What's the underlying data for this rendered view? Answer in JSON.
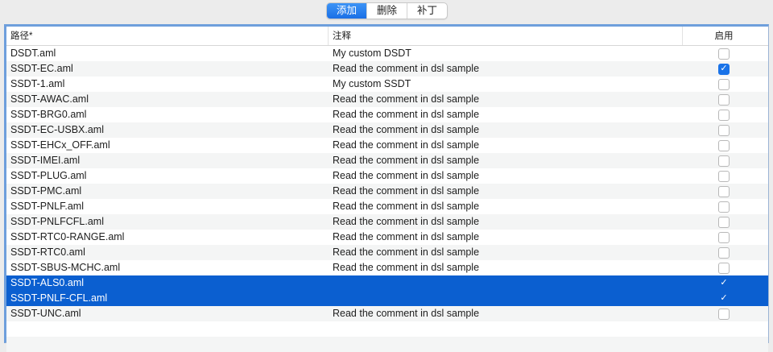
{
  "tabs": [
    {
      "label": "添加",
      "active": true
    },
    {
      "label": "删除",
      "active": false
    },
    {
      "label": "补丁",
      "active": false
    }
  ],
  "columns": {
    "path": "路径*",
    "comment": "注释",
    "enabled": "启用"
  },
  "rows": [
    {
      "path": "DSDT.aml",
      "comment": "My custom DSDT",
      "enabled": false,
      "selected": false
    },
    {
      "path": "SSDT-EC.aml",
      "comment": "Read the comment in dsl sample",
      "enabled": true,
      "selected": false
    },
    {
      "path": "SSDT-1.aml",
      "comment": "My custom SSDT",
      "enabled": false,
      "selected": false
    },
    {
      "path": "SSDT-AWAC.aml",
      "comment": "Read the comment in dsl sample",
      "enabled": false,
      "selected": false
    },
    {
      "path": "SSDT-BRG0.aml",
      "comment": "Read the comment in dsl sample",
      "enabled": false,
      "selected": false
    },
    {
      "path": "SSDT-EC-USBX.aml",
      "comment": "Read the comment in dsl sample",
      "enabled": false,
      "selected": false
    },
    {
      "path": "SSDT-EHCx_OFF.aml",
      "comment": "Read the comment in dsl sample",
      "enabled": false,
      "selected": false
    },
    {
      "path": "SSDT-IMEI.aml",
      "comment": "Read the comment in dsl sample",
      "enabled": false,
      "selected": false
    },
    {
      "path": "SSDT-PLUG.aml",
      "comment": "Read the comment in dsl sample",
      "enabled": false,
      "selected": false
    },
    {
      "path": "SSDT-PMC.aml",
      "comment": "Read the comment in dsl sample",
      "enabled": false,
      "selected": false
    },
    {
      "path": "SSDT-PNLF.aml",
      "comment": "Read the comment in dsl sample",
      "enabled": false,
      "selected": false
    },
    {
      "path": "SSDT-PNLFCFL.aml",
      "comment": "Read the comment in dsl sample",
      "enabled": false,
      "selected": false
    },
    {
      "path": "SSDT-RTC0-RANGE.aml",
      "comment": "Read the comment in dsl sample",
      "enabled": false,
      "selected": false
    },
    {
      "path": "SSDT-RTC0.aml",
      "comment": "Read the comment in dsl sample",
      "enabled": false,
      "selected": false
    },
    {
      "path": "SSDT-SBUS-MCHC.aml",
      "comment": "Read the comment in dsl sample",
      "enabled": false,
      "selected": false
    },
    {
      "path": "SSDT-ALS0.aml",
      "comment": "",
      "enabled": true,
      "selected": true
    },
    {
      "path": "SSDT-PNLF-CFL.aml",
      "comment": "",
      "enabled": true,
      "selected": true
    },
    {
      "path": "SSDT-UNC.aml",
      "comment": "Read the comment in dsl sample",
      "enabled": false,
      "selected": false
    }
  ]
}
